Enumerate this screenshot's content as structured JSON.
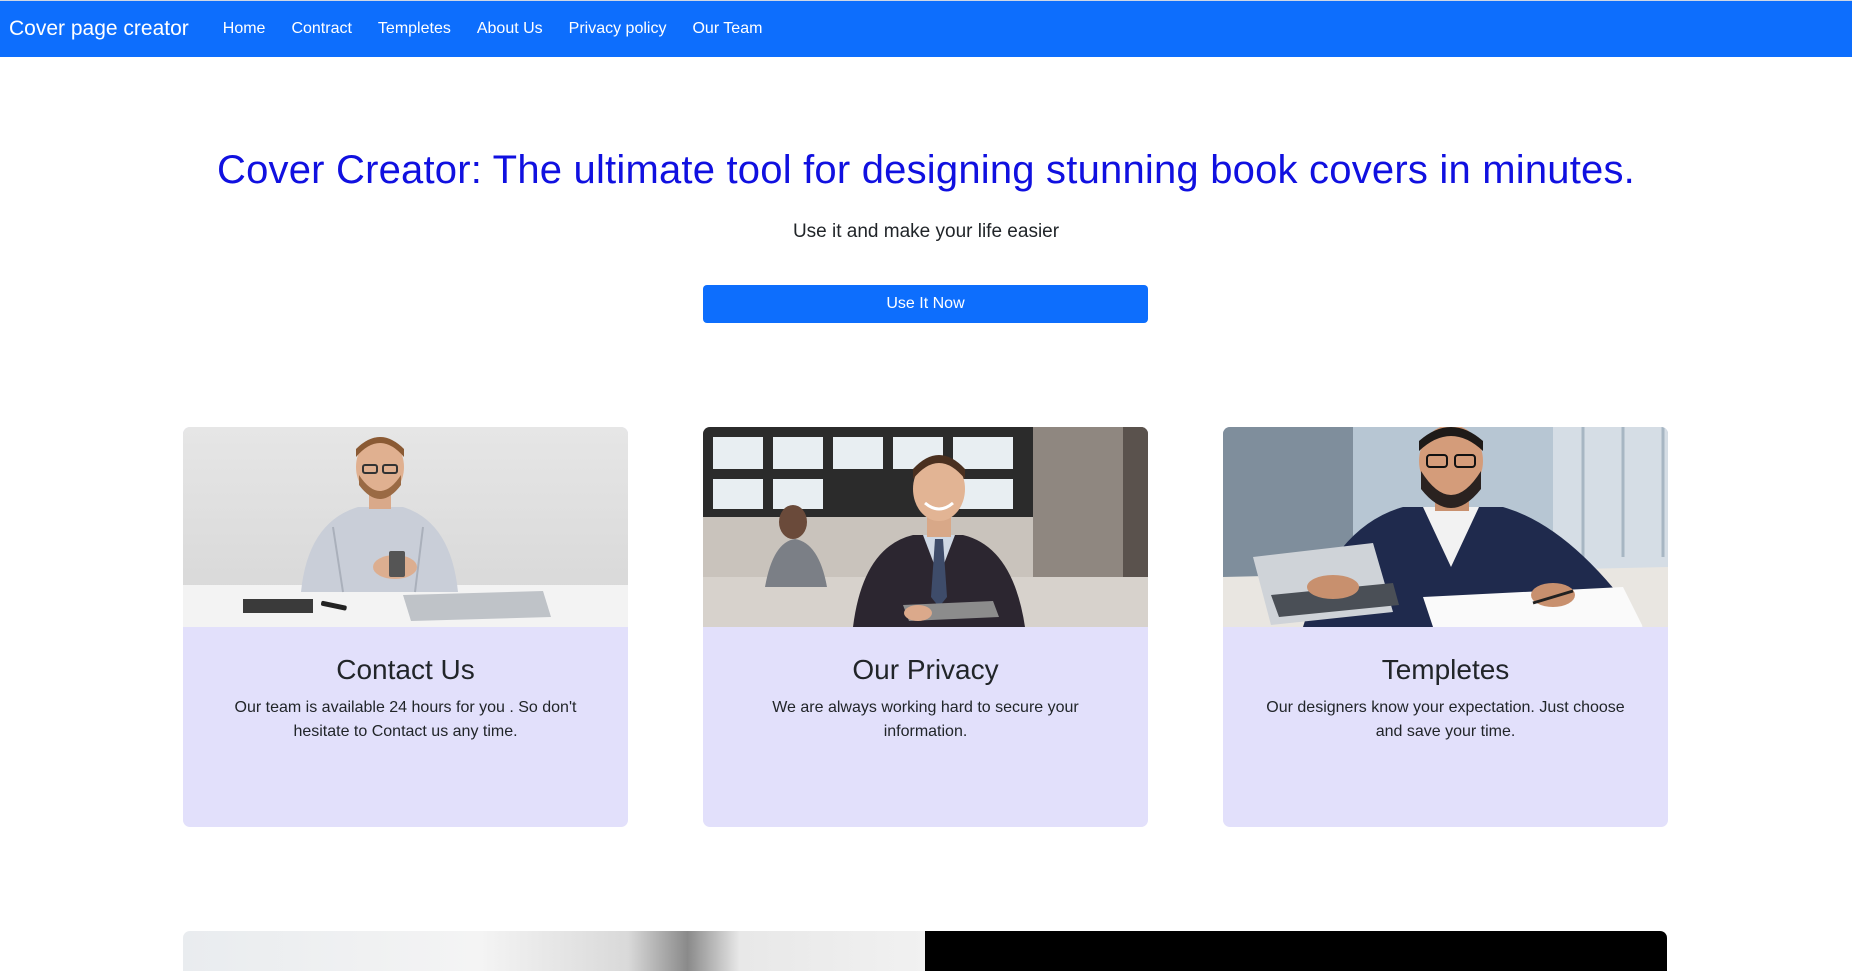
{
  "navbar": {
    "brand": "Cover page creator",
    "links": [
      "Home",
      "Contract",
      "Templetes",
      "About Us",
      "Privacy policy",
      "Our Team"
    ]
  },
  "hero": {
    "title": "Cover Creator: The ultimate tool for designing stunning book covers in minutes.",
    "subtitle": "Use it and make your life easier",
    "cta_label": "Use It Now"
  },
  "cards": [
    {
      "title": "Contact Us",
      "text": "Our team is available 24 hours for you . So don't hesitate to Contact us any time."
    },
    {
      "title": "Our Privacy",
      "text": "We are always working hard to secure your information."
    },
    {
      "title": "Templetes",
      "text": "Our designers know your expectation. Just choose and save your time."
    }
  ],
  "colors": {
    "primary": "#0d6efd",
    "hero_title": "#1010e0",
    "card_bg": "#e2e0fb"
  }
}
